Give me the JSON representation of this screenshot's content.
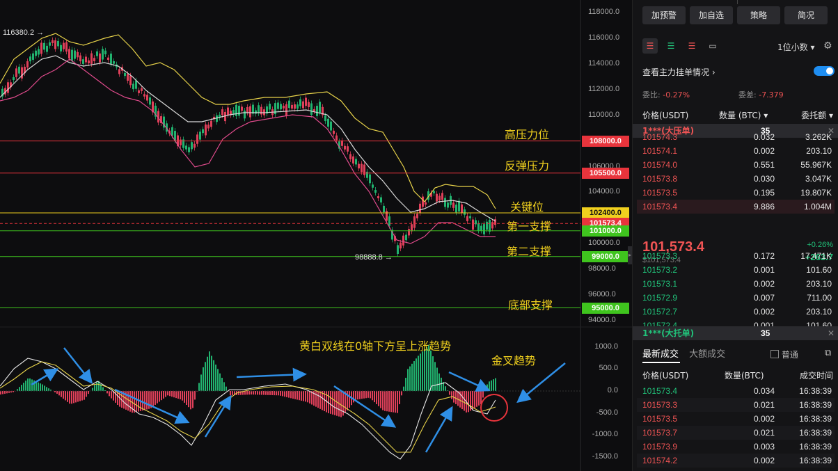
{
  "chart": {
    "price_axis": [
      "118000.0",
      "116000.0",
      "114000.0",
      "112000.0",
      "110000.0",
      "108000.0",
      "106000.0",
      "104000.0",
      "102000.0",
      "100000.0",
      "98000.0",
      "96000.0",
      "94000.0"
    ],
    "macd_axis": [
      "1000.0",
      "500.0",
      "0.0",
      "-500.0",
      "-1000.0",
      "-1500.0"
    ],
    "high_label": "116380.2 →",
    "low_label": "98888.8 →",
    "levels": [
      {
        "tag": "108000.0",
        "label": "高压力位",
        "color": "#e8343c"
      },
      {
        "tag": "105500.0",
        "label": "反弹压力",
        "color": "#e8343c"
      },
      {
        "tag": "102400.0",
        "label": "关键位",
        "color": "#f0d01e"
      },
      {
        "tag": "101573.4",
        "label": "第一支撑",
        "color": "#e8343c"
      },
      {
        "tag": "101000.0",
        "label": "",
        "color": "#3fc41e"
      },
      {
        "tag": "99000.0",
        "label": "第二支撑",
        "color": "#3fc41e"
      },
      {
        "tag": "95000.0",
        "label": "底部支撑",
        "color": "#3fc41e"
      }
    ],
    "annotations": {
      "macd_note": "黄白双线在0轴下方呈上涨趋势",
      "cross_note": "金叉趋势"
    }
  },
  "panel": {
    "buttons": [
      "加预警",
      "加自选",
      "策略",
      "简况"
    ],
    "decimal_select": "1位小数",
    "main_orders_link": "查看主力挂单情况",
    "ratio_label": "委比:",
    "ratio_value": "-0.27%",
    "diff_label": "委差:",
    "diff_value": "-7.379",
    "headers": {
      "price": "价格(USDT)",
      "qty": "数量 (BTC)",
      "total": "委托额"
    },
    "big_ask": {
      "label": "1***(大压单)",
      "qty": "35"
    },
    "asks": [
      {
        "price": "101574.3",
        "qty": "0.032",
        "total": "3.262K"
      },
      {
        "price": "101574.1",
        "qty": "0.002",
        "total": "203.10"
      },
      {
        "price": "101574.0",
        "qty": "0.551",
        "total": "55.967K"
      },
      {
        "price": "101573.8",
        "qty": "0.030",
        "total": "3.047K"
      },
      {
        "price": "101573.5",
        "qty": "0.195",
        "total": "19.807K"
      },
      {
        "price": "101573.4",
        "qty": "9.886",
        "total": "1.004M"
      }
    ],
    "last_price": "101,573.4",
    "last_price_usd": "$101,573.4",
    "change_pct": "+0.26%",
    "change_abs": "+263.7",
    "bids": [
      {
        "price": "101573.3",
        "qty": "0.172",
        "total": "17.471K"
      },
      {
        "price": "101573.2",
        "qty": "0.001",
        "total": "101.60"
      },
      {
        "price": "101573.1",
        "qty": "0.002",
        "total": "203.10"
      },
      {
        "price": "101572.9",
        "qty": "0.007",
        "total": "711.00"
      },
      {
        "price": "101572.7",
        "qty": "0.002",
        "total": "203.10"
      },
      {
        "price": "101572.4",
        "qty": "0.001",
        "total": "101.60"
      }
    ],
    "big_bid": {
      "label": "1***(大托单)",
      "qty": "35"
    },
    "trade_tabs": [
      "最新成交",
      "大额成交"
    ],
    "normal_label": "普通",
    "trade_headers": {
      "price": "价格(USDT)",
      "qty": "数量(BTC)",
      "time": "成交时间"
    },
    "trades": [
      {
        "price": "101573.4",
        "qty": "0.034",
        "time": "16:38:39",
        "side": "buy"
      },
      {
        "price": "101573.3",
        "qty": "0.021",
        "time": "16:38:39",
        "side": "sell"
      },
      {
        "price": "101573.5",
        "qty": "0.002",
        "time": "16:38:39",
        "side": "sell"
      },
      {
        "price": "101573.7",
        "qty": "0.021",
        "time": "16:38:39",
        "side": "sell"
      },
      {
        "price": "101573.9",
        "qty": "0.003",
        "time": "16:38:39",
        "side": "sell"
      },
      {
        "price": "101574.2",
        "qty": "0.002",
        "time": "16:38:39",
        "side": "sell"
      }
    ]
  }
}
